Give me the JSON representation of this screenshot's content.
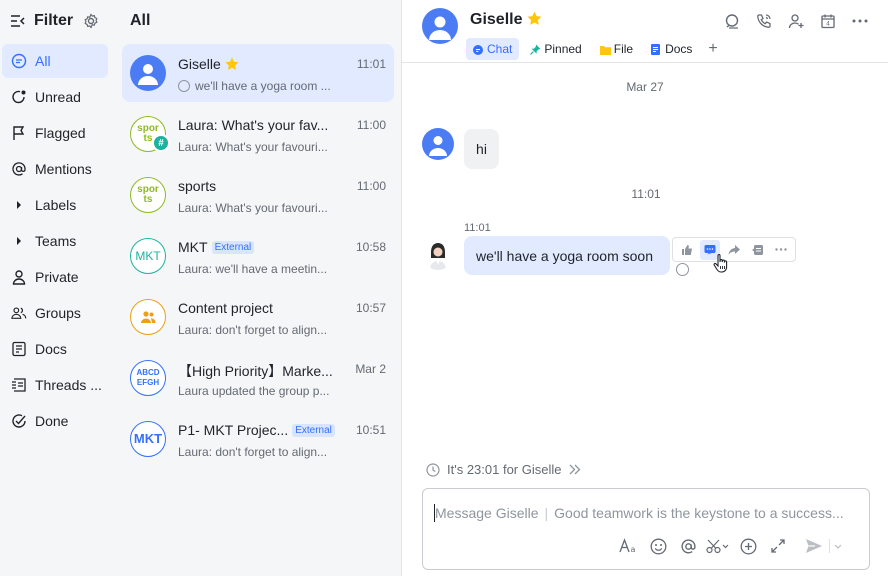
{
  "filter": {
    "title": "Filter",
    "items": [
      {
        "label": "All",
        "icon": "chat-icon"
      },
      {
        "label": "Unread",
        "icon": "unread-icon"
      },
      {
        "label": "Flagged",
        "icon": "flag-icon"
      },
      {
        "label": "Mentions",
        "icon": "at-icon"
      },
      {
        "label": "Labels",
        "icon": "caret-right-icon"
      },
      {
        "label": "Teams",
        "icon": "caret-right-icon"
      },
      {
        "label": "Private",
        "icon": "person-icon"
      },
      {
        "label": "Groups",
        "icon": "group-icon"
      },
      {
        "label": "Docs",
        "icon": "docs-icon"
      },
      {
        "label": "Threads ...",
        "icon": "threads-icon"
      },
      {
        "label": "Done",
        "icon": "done-icon"
      }
    ]
  },
  "list": {
    "title": "All",
    "chats": [
      {
        "name": "Giselle",
        "time": "11:01",
        "preview": "we'll have a yoga room ...",
        "avatar": "person-avatar"
      },
      {
        "name": "Laura: What's your fav...",
        "time": "11:00",
        "preview": "Laura: What's your favouri...",
        "avatar": "sports-group-avatar",
        "avatar_text": "spor ts"
      },
      {
        "name": "sports",
        "time": "11:00",
        "preview": "Laura: What's your favouri...",
        "avatar": "sports-avatar",
        "avatar_text": "spor ts"
      },
      {
        "name": "MKT",
        "badge": "External",
        "time": "10:58",
        "preview": "Laura: we'll have a meetin...",
        "avatar": "mkt-avatar",
        "avatar_text": "MKT"
      },
      {
        "name": "Content project",
        "time": "10:57",
        "preview": "Laura: don't forget to align...",
        "avatar": "group-avatar"
      },
      {
        "name": "【High Priority】Marke...",
        "time": "Mar 2",
        "preview": "Laura updated the group p...",
        "avatar": "abcd-avatar",
        "avatar_text": "ABCD EFGH"
      },
      {
        "name": "P1- MKT Projec...",
        "badge": "External",
        "time": "10:51",
        "preview": "Laura: don't forget to align...",
        "avatar": "mkt-bold-avatar",
        "avatar_text": "MKT"
      }
    ]
  },
  "chat": {
    "name": "Giselle",
    "tabs": [
      {
        "label": "Chat"
      },
      {
        "label": "Pinned"
      },
      {
        "label": "File"
      },
      {
        "label": "Docs"
      }
    ],
    "date_sep": "Mar 27",
    "time_sep": "11:01",
    "messages": [
      {
        "text": "hi"
      },
      {
        "time": "11:01",
        "text": "we'll have a yoga room soon"
      }
    ],
    "timezone_note": "It's 23:01 for Giselle",
    "composer_placeholder": "Message Giselle",
    "composer_hint": "Good teamwork is the keystone to a success..."
  },
  "colors": {
    "accent": "#3370ff",
    "active_bg": "#e1eaff",
    "sidebar_bg": "#f5f6f7"
  }
}
